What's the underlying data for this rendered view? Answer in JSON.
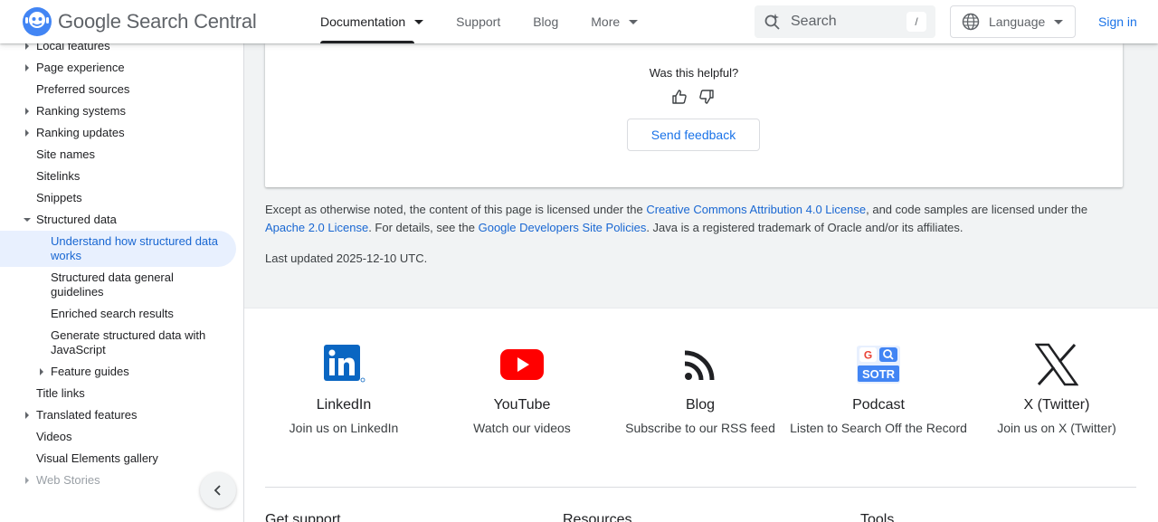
{
  "header": {
    "logo_text": "Google Search Central",
    "nav": [
      {
        "label": "Documentation"
      },
      {
        "label": "Support"
      },
      {
        "label": "Blog"
      },
      {
        "label": "More"
      }
    ],
    "search_placeholder": "Search",
    "search_shortcut": "/",
    "language_label": "Language",
    "signin_label": "Sign in"
  },
  "sidebar": {
    "items": [
      {
        "label": "Local features"
      },
      {
        "label": "Page experience"
      },
      {
        "label": "Preferred sources"
      },
      {
        "label": "Ranking systems"
      },
      {
        "label": "Ranking updates"
      },
      {
        "label": "Site names"
      },
      {
        "label": "Sitelinks"
      },
      {
        "label": "Snippets"
      },
      {
        "label": "Structured data"
      },
      {
        "label": "Understand how structured data works"
      },
      {
        "label": "Structured data general guidelines"
      },
      {
        "label": "Enriched search results"
      },
      {
        "label": "Generate structured data with JavaScript"
      },
      {
        "label": "Feature guides"
      },
      {
        "label": "Title links"
      },
      {
        "label": "Translated features"
      },
      {
        "label": "Videos"
      },
      {
        "label": "Visual Elements gallery"
      },
      {
        "label": "Web Stories"
      }
    ]
  },
  "feedback": {
    "question": "Was this helpful?",
    "button_label": "Send feedback"
  },
  "license": {
    "part1": "Except as otherwise noted, the content of this page is licensed under the ",
    "link1": "Creative Commons Attribution 4.0 License",
    "part2": ", and code samples are licensed under the ",
    "link2": "Apache 2.0 License",
    "part3": ". For details, see the ",
    "link3": "Google Developers Site Policies",
    "part4": ". Java is a registered trademark of Oracle and/or its affiliates.",
    "last_updated": "Last updated 2025-12-10 UTC."
  },
  "footer": {
    "social": [
      {
        "name": "LinkedIn",
        "desc": "Join us on LinkedIn",
        "icon": "linkedin-icon"
      },
      {
        "name": "YouTube",
        "desc": "Watch our videos",
        "icon": "youtube-icon"
      },
      {
        "name": "Blog",
        "desc": "Subscribe to our RSS feed",
        "icon": "rss-icon"
      },
      {
        "name": "Podcast",
        "desc": "Listen to Search Off the Record",
        "icon": "sotr-icon"
      },
      {
        "name": "X (Twitter)",
        "desc": "Join us on X (Twitter)",
        "icon": "x-icon"
      }
    ],
    "columns": [
      {
        "label": "Get support"
      },
      {
        "label": "Resources"
      },
      {
        "label": "Tools"
      }
    ]
  },
  "colors": {
    "accent": "#1a73e8",
    "selected_bg": "#e8f0fe",
    "page_bg": "#f1f3f4"
  }
}
